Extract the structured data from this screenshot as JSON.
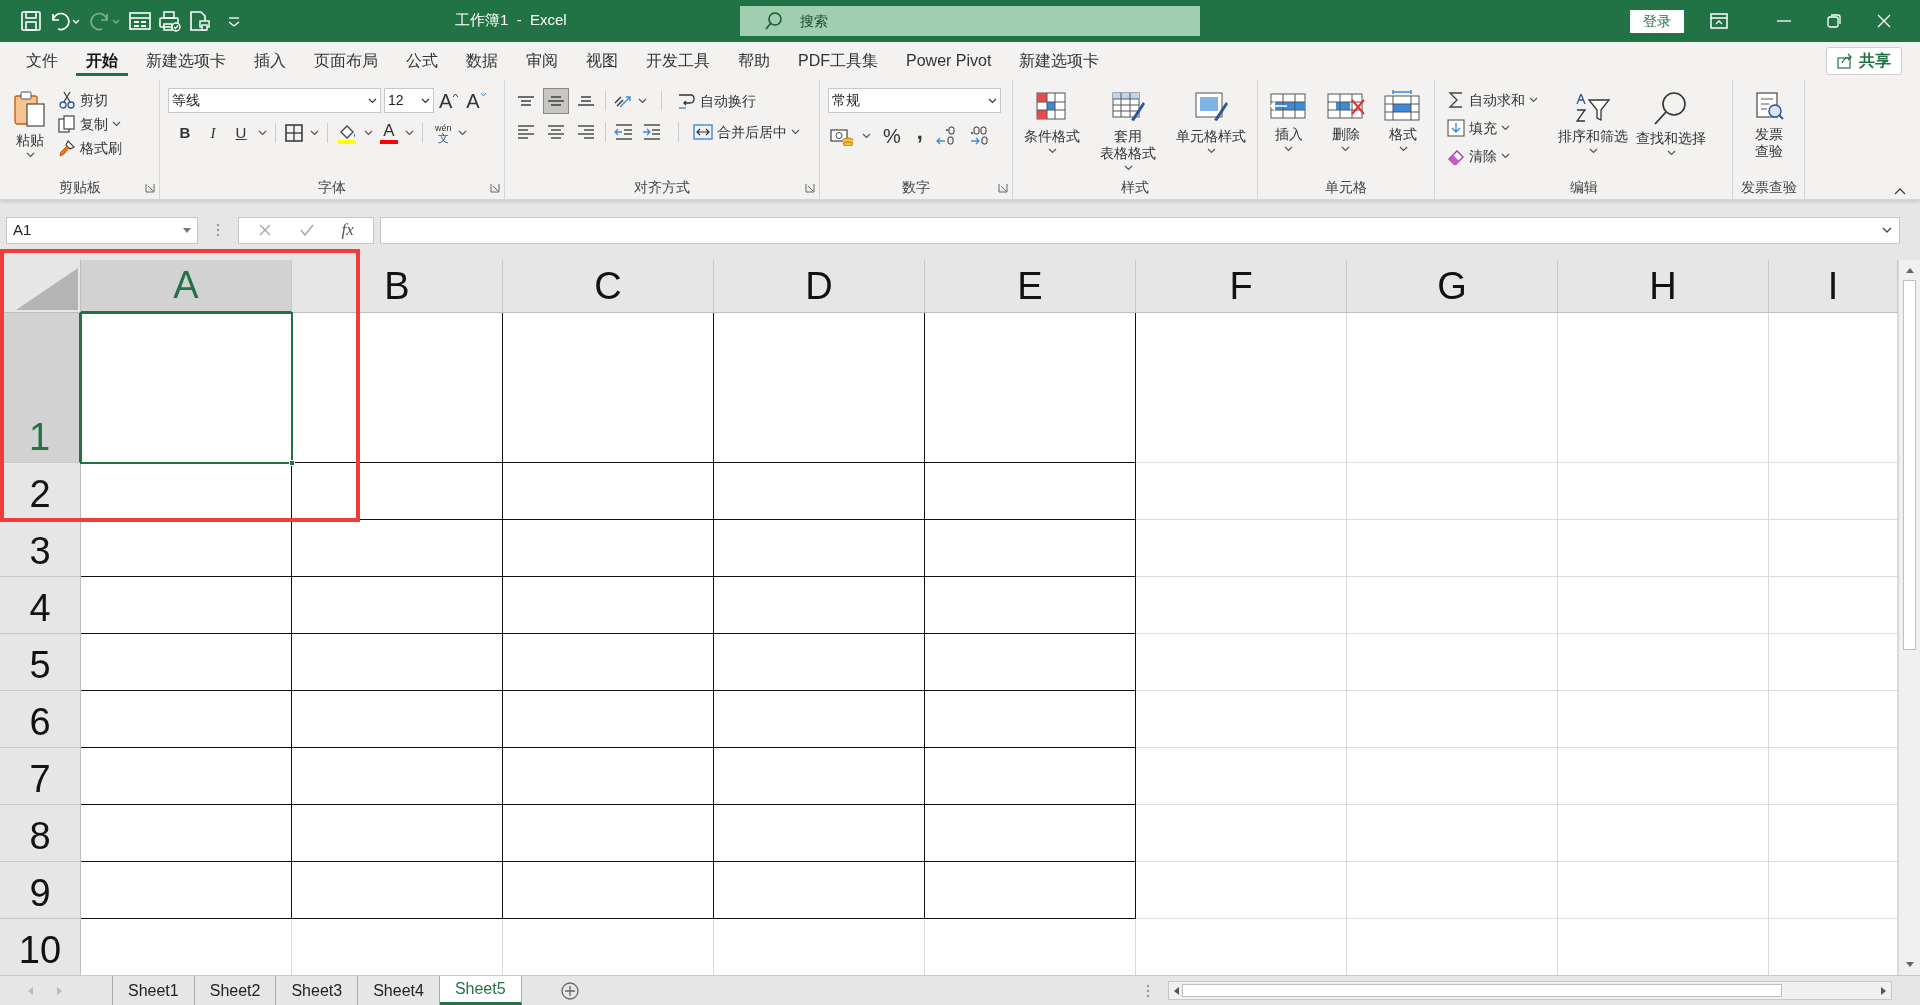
{
  "title_bar": {
    "title": "工作簿1  -  Excel",
    "search": {
      "placeholder": "搜索"
    },
    "sign_in": "登录"
  },
  "quick_access": [
    {
      "kind": "save",
      "disabled": false
    },
    {
      "kind": "undo",
      "disabled": false
    },
    {
      "kind": "redo",
      "disabled": true
    },
    {
      "kind": "form",
      "disabled": false
    },
    {
      "kind": "print",
      "disabled": false
    },
    {
      "kind": "preview",
      "disabled": false
    },
    {
      "kind": "customize",
      "disabled": false
    }
  ],
  "menu_tabs": [
    {
      "label": "文件",
      "selected": false
    },
    {
      "label": "开始",
      "selected": true
    },
    {
      "label": "新建选项卡",
      "selected": false
    },
    {
      "label": "插入",
      "selected": false
    },
    {
      "label": "页面布局",
      "selected": false
    },
    {
      "label": "公式",
      "selected": false
    },
    {
      "label": "数据",
      "selected": false
    },
    {
      "label": "审阅",
      "selected": false
    },
    {
      "label": "视图",
      "selected": false
    },
    {
      "label": "开发工具",
      "selected": false
    },
    {
      "label": "帮助",
      "selected": false
    },
    {
      "label": "PDF工具集",
      "selected": false
    },
    {
      "label": "Power Pivot",
      "selected": false
    },
    {
      "label": "新建选项卡",
      "selected": false
    }
  ],
  "share": "共享",
  "ribbon_groups": [
    {
      "kind": "clipboard",
      "label": "剪贴板",
      "launcher": true,
      "paste": "粘贴",
      "small": [
        "剪切",
        "复制",
        "格式刷"
      ]
    },
    {
      "kind": "font",
      "label": "字体",
      "launcher": true,
      "font": "等线",
      "size": "12",
      "size_buttons": [
        "A",
        "A"
      ],
      "styles": [
        "B",
        "I",
        "U"
      ],
      "font_color": "A",
      "phonetic": [
        "wén",
        "文"
      ]
    },
    {
      "kind": "alignment",
      "label": "对齐方式",
      "launcher": true,
      "vertical_align": [
        {
          "selected": false
        },
        {
          "selected": true
        },
        {
          "selected": false
        }
      ],
      "wrap": "自动换行",
      "merge": "合并后居中"
    },
    {
      "kind": "number",
      "label": "数字",
      "launcher": true,
      "format": "常规",
      "percent": "%",
      "comma": ","
    },
    {
      "kind": "styles",
      "label": "样式",
      "launcher": false,
      "buttons": [
        [
          "条件格式"
        ],
        [
          "套用",
          "表格格式"
        ],
        [
          "单元格样式"
        ]
      ]
    },
    {
      "kind": "cells",
      "label": "单元格",
      "launcher": false,
      "buttons": [
        "插入",
        "删除",
        "格式"
      ]
    },
    {
      "kind": "editing",
      "label": "编辑",
      "launcher": false,
      "small": [
        "自动求和",
        "填充",
        "清除"
      ],
      "large": [
        "排序和筛选",
        "查找和选择"
      ]
    },
    {
      "kind": "invoice",
      "label": "发票查验",
      "launcher": false,
      "button": [
        "发票",
        "查验"
      ]
    }
  ],
  "name_box": "A1",
  "function_button": "fx",
  "columns": [
    {
      "label": "A",
      "selected": true,
      "bordered": true
    },
    {
      "label": "B",
      "selected": false,
      "bordered": true
    },
    {
      "label": "C",
      "selected": false,
      "bordered": true
    },
    {
      "label": "D",
      "selected": false,
      "bordered": true
    },
    {
      "label": "E",
      "selected": false,
      "bordered": true
    },
    {
      "label": "F",
      "selected": false,
      "bordered": false
    },
    {
      "label": "G",
      "selected": false,
      "bordered": false
    },
    {
      "label": "H",
      "selected": false,
      "bordered": false
    },
    {
      "label": "I",
      "selected": false,
      "bordered": false
    }
  ],
  "rows": [
    {
      "label": "1",
      "selected": true,
      "bordered": true
    },
    {
      "label": "2",
      "selected": false,
      "bordered": true
    },
    {
      "label": "3",
      "selected": false,
      "bordered": true
    },
    {
      "label": "4",
      "selected": false,
      "bordered": true
    },
    {
      "label": "5",
      "selected": false,
      "bordered": true
    },
    {
      "label": "6",
      "selected": false,
      "bordered": true
    },
    {
      "label": "7",
      "selected": false,
      "bordered": true
    },
    {
      "label": "8",
      "selected": false,
      "bordered": true
    },
    {
      "label": "9",
      "selected": false,
      "bordered": true
    },
    {
      "label": "10",
      "selected": false,
      "bordered": false
    }
  ],
  "sheet_tabs": [
    {
      "label": "Sheet1",
      "selected": false
    },
    {
      "label": "Sheet2",
      "selected": false
    },
    {
      "label": "Sheet3",
      "selected": false
    },
    {
      "label": "Sheet4",
      "selected": false
    },
    {
      "label": "Sheet5",
      "selected": true
    }
  ]
}
